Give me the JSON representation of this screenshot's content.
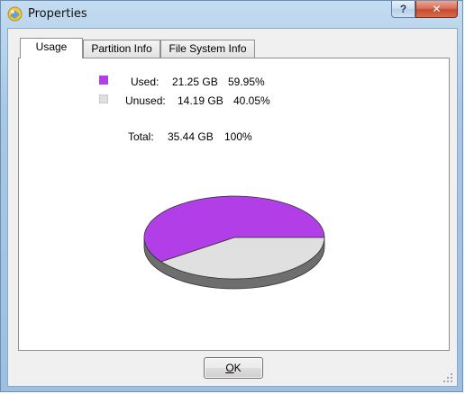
{
  "window": {
    "title": "Properties",
    "help_glyph": "?",
    "close_glyph": "✕"
  },
  "tabs": [
    {
      "label": "Usage",
      "active": true
    },
    {
      "label": "Partition Info",
      "active": false
    },
    {
      "label": "File System Info",
      "active": false
    }
  ],
  "usage": {
    "used": {
      "label": "Used:",
      "size": "21.25 GB",
      "percent": "59.95%",
      "color": "#b23ee8"
    },
    "unused": {
      "label": "Unused:",
      "size": "14.19 GB",
      "percent": "40.05%",
      "color": "#e0e0e0"
    },
    "total": {
      "label": "Total:",
      "size": "35.44 GB",
      "percent": "100%"
    },
    "used_fraction": 0.5995
  },
  "buttons": {
    "ok_first": "O",
    "ok_rest": "K"
  },
  "colors": {
    "used": "#b23ee8",
    "unused": "#e0e0e0",
    "pie_side": "#6e6e6e"
  }
}
